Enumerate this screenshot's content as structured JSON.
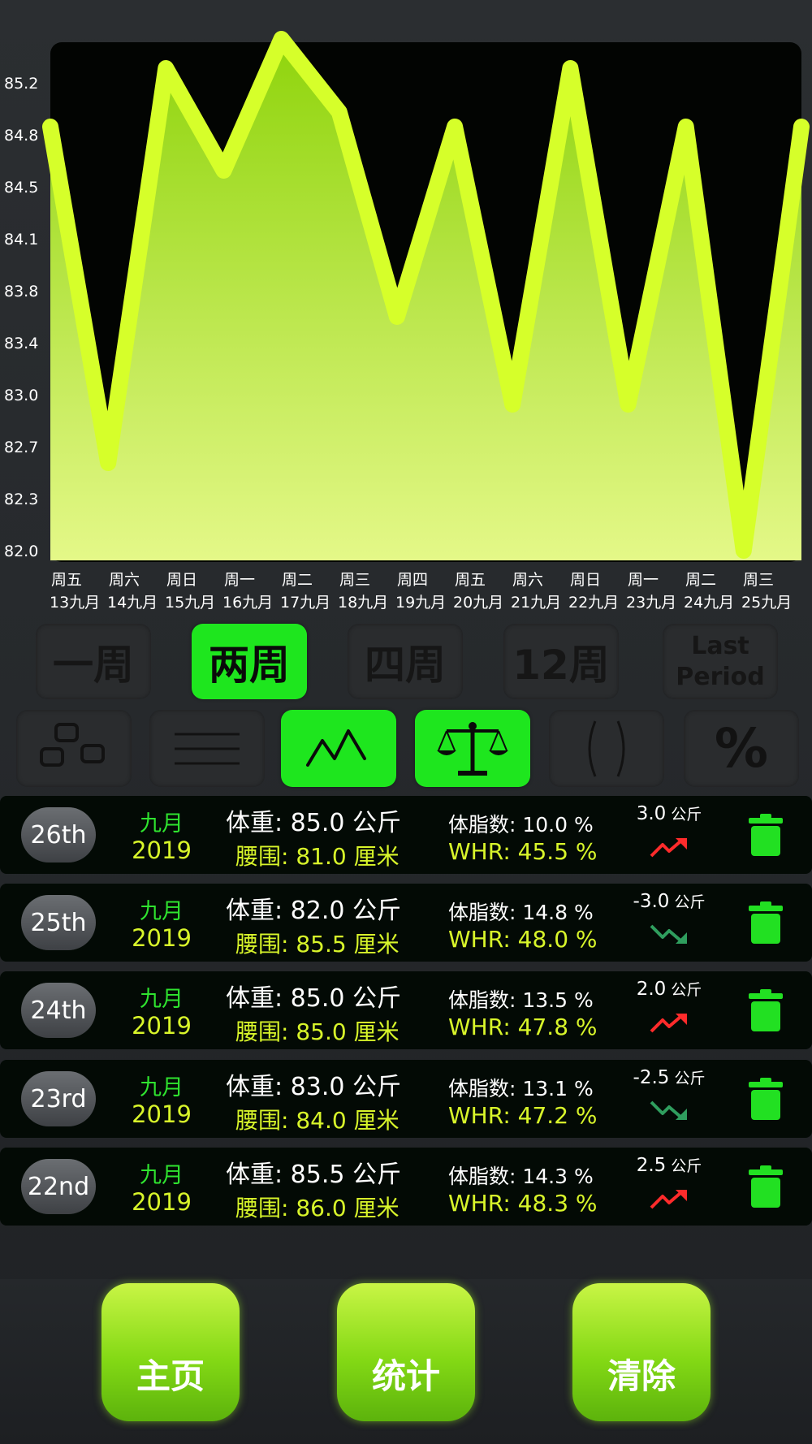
{
  "chart_data": {
    "type": "area",
    "x": [
      "13九月",
      "14九月",
      "15九月",
      "16九月",
      "17九月",
      "18九月",
      "19九月",
      "20九月",
      "21九月",
      "22九月",
      "23九月",
      "24九月",
      "25九月"
    ],
    "weekdays": [
      "周五",
      "周六",
      "周日",
      "周一",
      "周二",
      "周三",
      "周四",
      "周五",
      "周六",
      "周日",
      "周一",
      "周二",
      "周三"
    ],
    "values": [
      84.9,
      82.6,
      85.3,
      84.6,
      85.5,
      85.0,
      83.6,
      84.9,
      83.0,
      85.3,
      83.0,
      84.9,
      82.0,
      84.9
    ],
    "y_ticks": [
      "85.2",
      "84.8",
      "84.5",
      "84.1",
      "83.8",
      "83.4",
      "83.0",
      "82.7",
      "82.3",
      "82.0"
    ],
    "ylim": [
      82.0,
      85.2
    ],
    "title": "",
    "xlabel": "",
    "ylabel": "",
    "line_color": "#d6ff2a",
    "fill_top": "#8fd40c",
    "fill_bottom": "#e4f888"
  },
  "periods": [
    {
      "label": "一周",
      "active": false
    },
    {
      "label": "两周",
      "active": true
    },
    {
      "label": "四周",
      "active": false
    },
    {
      "label": "12周",
      "active": false
    },
    {
      "label_line1": "Last",
      "label_line2": "Period",
      "active": false
    }
  ],
  "modes": [
    {
      "icon": "tiles-icon",
      "active": false
    },
    {
      "icon": "list-lines-icon",
      "active": false
    },
    {
      "icon": "line-chart-icon",
      "active": true
    },
    {
      "icon": "balance-scale-icon",
      "active": true
    },
    {
      "icon": "waist-icon",
      "active": false
    },
    {
      "icon": "percent-icon",
      "active": false
    }
  ],
  "percent_glyph": "%",
  "entries": [
    {
      "day": "26th",
      "month": "九月",
      "year": "2019",
      "weight": "体重: 85.0 公斤",
      "waist": "腰围: 81.0 厘米",
      "fat": "体脂数: 10.0 %",
      "whr": "WHR: 45.5 %",
      "delta": "3.0",
      "delta_unit": "公斤",
      "trend": "up"
    },
    {
      "day": "25th",
      "month": "九月",
      "year": "2019",
      "weight": "体重: 82.0 公斤",
      "waist": "腰围: 85.5 厘米",
      "fat": "体脂数: 14.8 %",
      "whr": "WHR: 48.0 %",
      "delta": "-3.0",
      "delta_unit": "公斤",
      "trend": "down"
    },
    {
      "day": "24th",
      "month": "九月",
      "year": "2019",
      "weight": "体重: 85.0 公斤",
      "waist": "腰围: 85.0 厘米",
      "fat": "体脂数: 13.5 %",
      "whr": "WHR: 47.8 %",
      "delta": "2.0",
      "delta_unit": "公斤",
      "trend": "up"
    },
    {
      "day": "23rd",
      "month": "九月",
      "year": "2019",
      "weight": "体重: 83.0 公斤",
      "waist": "腰围: 84.0 厘米",
      "fat": "体脂数: 13.1 %",
      "whr": "WHR: 47.2 %",
      "delta": "-2.5",
      "delta_unit": "公斤",
      "trend": "down"
    },
    {
      "day": "22nd",
      "month": "九月",
      "year": "2019",
      "weight": "体重: 85.5 公斤",
      "waist": "腰围: 86.0 厘米",
      "fat": "体脂数: 14.3 %",
      "whr": "WHR: 48.3 %",
      "delta": "2.5",
      "delta_unit": "公斤",
      "trend": "up"
    }
  ],
  "nav": {
    "home": "主页",
    "stats": "统计",
    "clear": "清除"
  },
  "colors": {
    "active_green": "#1ee61e",
    "trend_up": "#ff2b2b",
    "trend_down": "#2f9e5e",
    "trash": "#22e022"
  }
}
